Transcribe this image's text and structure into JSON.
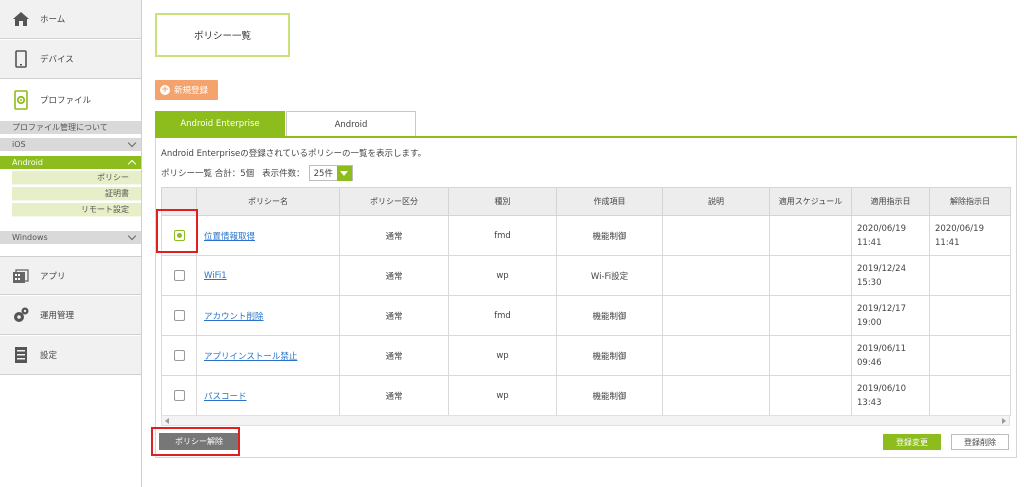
{
  "sidebar": {
    "home": "ホーム",
    "device": "デバイス",
    "profile": "プロファイル",
    "profile_about": "プロファイル管理について",
    "ios": "iOS",
    "android": "Android",
    "android_items": [
      "ポリシー",
      "証明書",
      "リモート設定"
    ],
    "windows": "Windows",
    "app": "アプリ",
    "operation": "運用管理",
    "settings": "設定"
  },
  "page": {
    "title": "ポリシー一覧",
    "new_button": "新規登録",
    "tabs": [
      "Android Enterprise",
      "Android"
    ],
    "description": "Android Enterpriseの登録されているポリシーの一覧を表示します。",
    "count_text": "ポリシー一覧 合計：5個",
    "per_page_label": "表示件数：",
    "per_page_value": "25件"
  },
  "table": {
    "headers": [
      "",
      "ポリシー名",
      "ポリシー区分",
      "種別",
      "作成項目",
      "説明",
      "適用スケジュール",
      "適用指示日",
      "解除指示日"
    ],
    "rows": [
      {
        "checked": true,
        "name": "位置情報取得",
        "category": "通常",
        "type": "fmd",
        "item": "機能制御",
        "desc": "",
        "schedule": "",
        "apply_date": "2020/06/19",
        "apply_time": "11:41",
        "release_date": "2020/06/19",
        "release_time": "11:41"
      },
      {
        "checked": false,
        "name": "WiFi1",
        "category": "通常",
        "type": "wp",
        "item": "Wi-Fi設定",
        "desc": "",
        "schedule": "",
        "apply_date": "2019/12/24",
        "apply_time": "15:30",
        "release_date": "",
        "release_time": ""
      },
      {
        "checked": false,
        "name": "アカウント削除",
        "category": "通常",
        "type": "fmd",
        "item": "機能制御",
        "desc": "",
        "schedule": "",
        "apply_date": "2019/12/17",
        "apply_time": "19:00",
        "release_date": "",
        "release_time": ""
      },
      {
        "checked": false,
        "name": "アプリインストール禁止",
        "category": "通常",
        "type": "wp",
        "item": "機能制御",
        "desc": "",
        "schedule": "",
        "apply_date": "2019/06/11",
        "apply_time": "09:46",
        "release_date": "",
        "release_time": ""
      },
      {
        "checked": false,
        "name": "パスコード",
        "category": "通常",
        "type": "wp",
        "item": "機能制御",
        "desc": "",
        "schedule": "",
        "apply_date": "2019/06/10",
        "apply_time": "13:43",
        "release_date": "",
        "release_time": ""
      }
    ]
  },
  "footer": {
    "release_button": "ポリシー解除",
    "change_button": "登録変更",
    "delete_button": "登録削除"
  },
  "colors": {
    "accent_green": "#8dbd1c",
    "new_button_orange": "#f4a36c",
    "highlight_red": "#e02020",
    "link_blue": "#2a73c8"
  }
}
